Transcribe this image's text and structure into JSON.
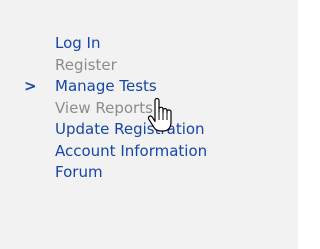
{
  "menu": {
    "items": [
      {
        "label": "Log In",
        "enabled": true,
        "active": false
      },
      {
        "label": "Register",
        "enabled": false,
        "active": false
      },
      {
        "label": "Manage Tests",
        "enabled": true,
        "active": true
      },
      {
        "label": "View Reports",
        "enabled": false,
        "active": false
      },
      {
        "label": "Update Registration",
        "enabled": true,
        "active": false
      },
      {
        "label": "Account Information",
        "enabled": true,
        "active": false
      },
      {
        "label": "Forum",
        "enabled": true,
        "active": false
      }
    ],
    "active_marker": ">"
  },
  "cursor": {
    "icon": "hand-pointer-icon"
  },
  "colors": {
    "link": "#1646a8",
    "disabled": "#8c8c8c",
    "panel_bg": "#f2f2f2"
  }
}
